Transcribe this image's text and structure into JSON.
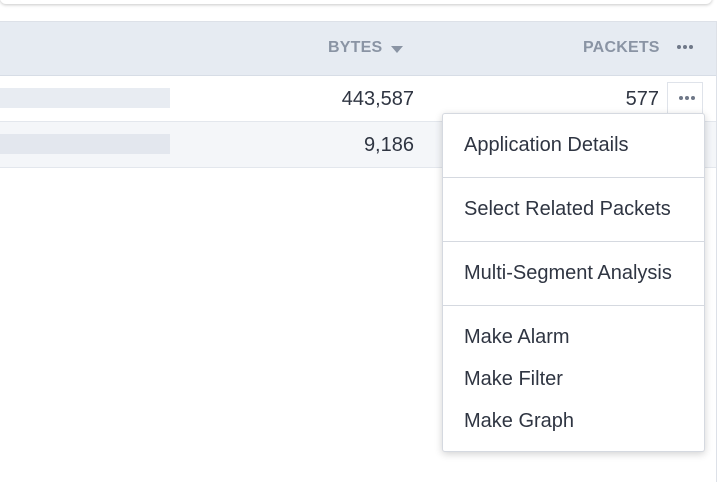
{
  "table": {
    "headers": {
      "bytes": "BYTES",
      "packets": "PACKETS"
    },
    "sort": {
      "column": "bytes",
      "direction": "descending"
    },
    "rows": [
      {
        "bytes": "443,587",
        "packets": "577"
      },
      {
        "bytes": "9,186",
        "packets": ""
      }
    ]
  },
  "icons": {
    "header_menu": "ellipsis-icon",
    "row_menu": "ellipsis-icon",
    "sort": "sort-down-icon"
  },
  "context_menu": {
    "items": [
      "Application Details",
      "Select Related Packets",
      "Multi-Segment Analysis",
      "Make Alarm",
      "Make Filter",
      "Make Graph"
    ]
  },
  "colors": {
    "header_bg": "#e6ebf2",
    "header_text": "#8a94a4",
    "body_text": "#2f3542",
    "row_alt_bg": "#f4f6f9"
  }
}
